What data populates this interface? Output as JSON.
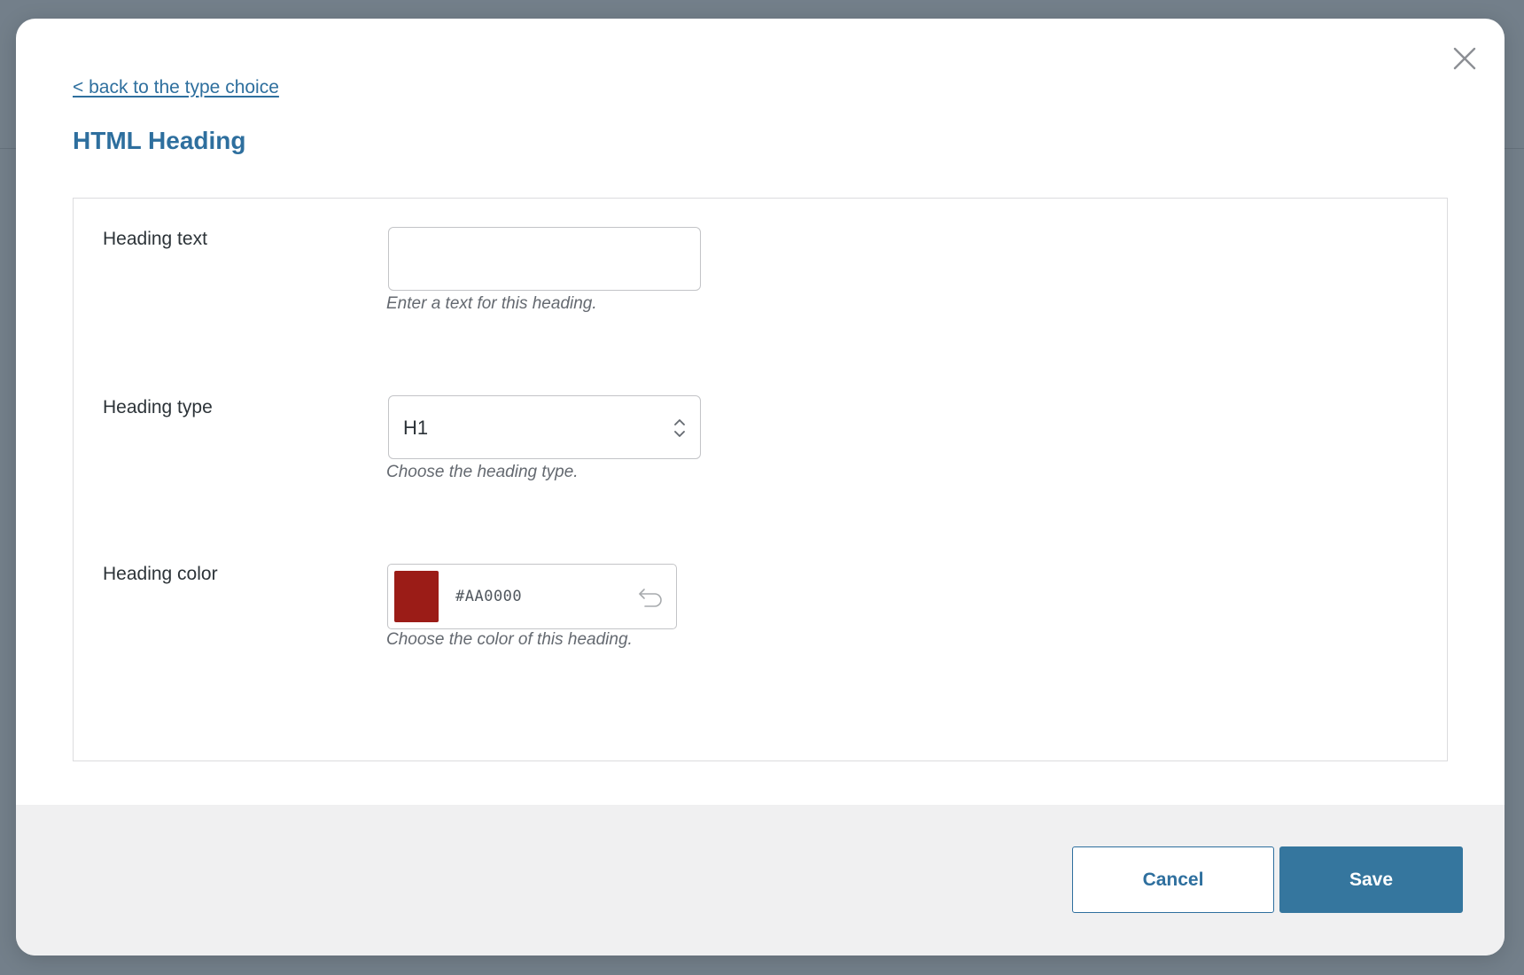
{
  "modal": {
    "back_link": "< back to the type choice",
    "title": "HTML Heading",
    "fields": {
      "heading_text": {
        "label": "Heading text",
        "value": "",
        "placeholder": "",
        "help": "Enter a text for this heading."
      },
      "heading_type": {
        "label": "Heading type",
        "value": "H1",
        "help": "Choose the heading type."
      },
      "heading_color": {
        "label": "Heading color",
        "value": "#AA0000",
        "swatch_color": "#9b1c17",
        "help": "Choose the color of this heading."
      }
    },
    "footer": {
      "cancel_label": "Cancel",
      "save_label": "Save"
    }
  },
  "icons": {
    "close": "close-icon",
    "select_arrows": "chevron-up-down-icon",
    "reset": "undo-icon"
  },
  "colors": {
    "accent": "#2e6f9e",
    "primary_button": "#35769e",
    "footer_bg": "#f0f0f1",
    "overlay": "#737f8a"
  }
}
